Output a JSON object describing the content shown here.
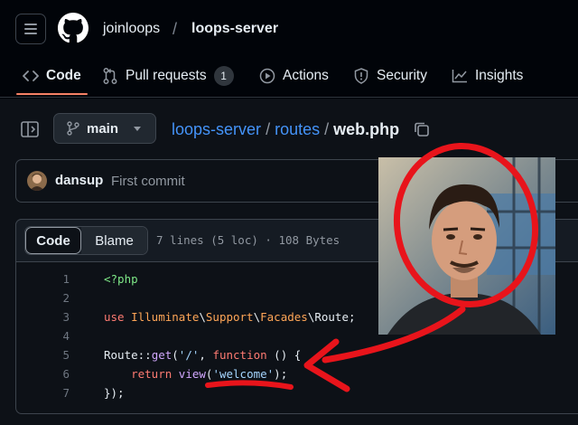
{
  "header": {
    "owner": "joinloops",
    "separator": "/",
    "repo": "loops-server"
  },
  "tabs": [
    {
      "label": "Code",
      "icon": "code-icon",
      "active": true
    },
    {
      "label": "Pull requests",
      "icon": "pull-request-icon",
      "count": "1"
    },
    {
      "label": "Actions",
      "icon": "play-icon"
    },
    {
      "label": "Security",
      "icon": "shield-icon"
    },
    {
      "label": "Insights",
      "icon": "graph-icon"
    }
  ],
  "branch": {
    "name": "main"
  },
  "path": {
    "repo": "loops-server",
    "folder": "routes",
    "file": "web.php",
    "sep1": "/",
    "sep2": "/"
  },
  "commit": {
    "author": "dansup",
    "message": "First commit"
  },
  "file": {
    "view_code": "Code",
    "view_blame": "Blame",
    "stats": "7 lines (5 loc) · 108 Bytes"
  },
  "code": {
    "line_numbers": [
      "1",
      "2",
      "3",
      "4",
      "5",
      "6",
      "7"
    ],
    "l1": "<?php",
    "l3_kw": "use",
    "l3_a": "Illuminate",
    "l3_b": "\\",
    "l3_c": "Support",
    "l3_d": "\\",
    "l3_e": "Facades",
    "l3_f": "\\",
    "l3_g": "Route;",
    "l5_a": "Route::",
    "l5_b": "get",
    "l5_c": "(",
    "l5_d": "'/'",
    "l5_e": ", ",
    "l5_f": "function",
    "l5_g": " () {",
    "l6_indent": "    ",
    "l6_a": "return",
    "l6_b": " ",
    "l6_c": "view",
    "l6_d": "(",
    "l6_e": "'welcome'",
    "l6_f": ");",
    "l7": "});"
  },
  "colors": {
    "accent_underline": "#f78166",
    "link": "#4493f8",
    "annotation_red": "#e8141b"
  }
}
